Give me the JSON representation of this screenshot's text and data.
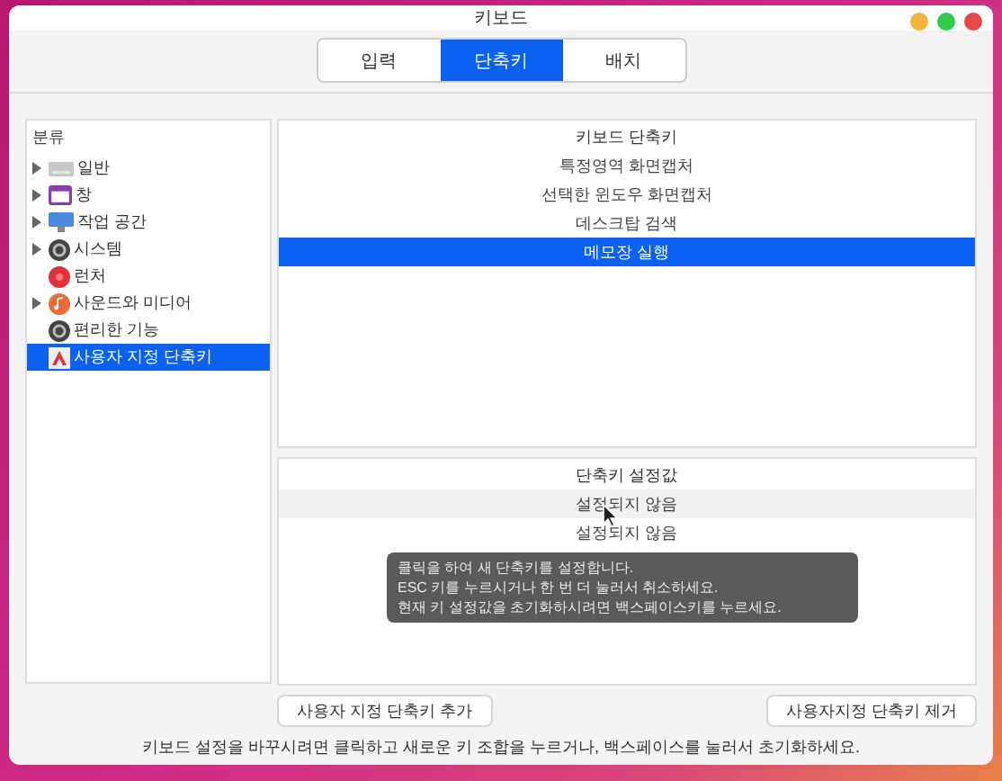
{
  "window": {
    "title": "키보드"
  },
  "tabs": [
    {
      "label": "입력",
      "selected": false
    },
    {
      "label": "단축키",
      "selected": true
    },
    {
      "label": "배치",
      "selected": false
    }
  ],
  "categories": {
    "header": "분류",
    "items": [
      {
        "label": "일반",
        "kind": "keyboard",
        "expandable": true,
        "selected": false
      },
      {
        "label": "창",
        "kind": "window",
        "expandable": true,
        "selected": false
      },
      {
        "label": "작업 공간",
        "kind": "monitor",
        "expandable": true,
        "selected": false
      },
      {
        "label": "시스템",
        "kind": "gear",
        "expandable": true,
        "selected": false
      },
      {
        "label": "런처",
        "kind": "launcher",
        "expandable": false,
        "selected": false
      },
      {
        "label": "사운드와 미디어",
        "kind": "music",
        "expandable": true,
        "selected": false
      },
      {
        "label": "편리한 기능",
        "kind": "gear",
        "expandable": false,
        "selected": false
      },
      {
        "label": "사용자 지정 단축키",
        "kind": "custom",
        "expandable": false,
        "selected": true
      }
    ]
  },
  "shortcuts": {
    "header": "키보드 단축키",
    "rows": [
      {
        "label": "특정영역 화면캡처",
        "selected": false
      },
      {
        "label": "선택한 윈도우 화면캡처",
        "selected": false
      },
      {
        "label": "데스크탑 검색",
        "selected": false
      },
      {
        "label": "메모장 실행",
        "selected": true
      }
    ]
  },
  "bindings": {
    "header": "단축키 설정값",
    "rows": [
      {
        "label": "설정되지 않음",
        "hovered": true
      },
      {
        "label": "설정되지 않음",
        "hovered": false
      }
    ]
  },
  "tooltip": {
    "lines": [
      "클릭을 하여 새 단축키를 설정합니다.",
      "ESC 키를 누르시거나 한 번 더 눌러서 취소하세요.",
      "현재 키 설정값을 초기화하시려면 백스페이스키를 누르세요."
    ]
  },
  "buttons": {
    "add": "사용자 지정 단축키 추가",
    "remove": "사용자지정 단축키 제거"
  },
  "status_bar": "키보드 설정을 바꾸시려면 클릭하고 새로운 키 조합을 누르거나, 백스페이스를 눌러서 초기화하세요."
}
